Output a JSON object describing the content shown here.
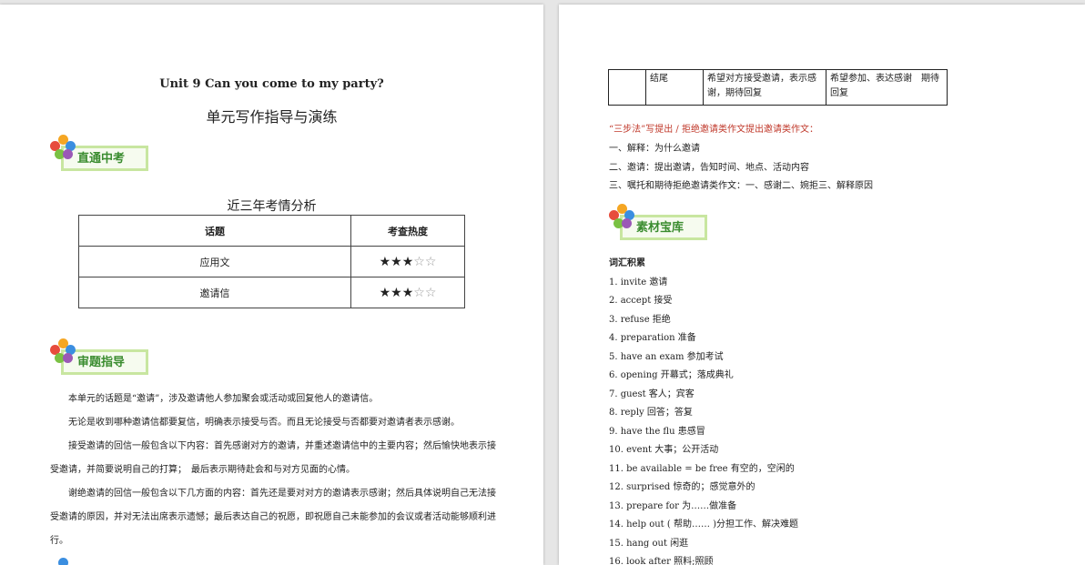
{
  "left": {
    "title_en": "Unit 9 Can you come to my party?",
    "title_cn": "单元写作指导与演练",
    "badge1": "直通中考",
    "table_title": "近三年考情分析",
    "table": {
      "headers": [
        "话题",
        "考查热度"
      ],
      "rows": [
        {
          "topic": "应用文",
          "stars_filled": "★★★",
          "stars_empty": "☆☆"
        },
        {
          "topic": "邀请信",
          "stars_filled": "★★★",
          "stars_empty": "☆☆"
        }
      ]
    },
    "badge2": "审题指导",
    "paragraphs": [
      "本单元的话题是“邀请”，涉及邀请他人参加聚会或活动或回复他人的邀请信。",
      "无论是收到哪种邀请信都要复信，明确表示接受与否。而且无论接受与否都要对邀请者表示感谢。",
      "接受邀请的回信一般包含以下内容：首先感谢对方的邀请，并重述邀请信中的主要内容；然后愉快地表示接受邀请，并简要说明自己的打算；　最后表示期待赴会和与对方见面的心情。",
      "谢绝邀请的回信一般包含以下几方面的内容：首先还是要对对方的邀请表示感谢；然后具体说明自己无法接受邀请的原因，并对无法出席表示遗憾；最后表达自己的祝愿，即祝愿自己未能参加的会议或者活动能够顺利进行。"
    ]
  },
  "right": {
    "table_row": [
      "",
      "结尾",
      "希望对方接受邀请，表示感谢，期待回复",
      "希望参加、表达感谢　期待回复"
    ],
    "red_heading": "“三步法”写提出 / 拒绝邀请类作文提出邀请类作文：",
    "steps": [
      "一、解释：为什么邀请",
      "二、邀请：提出邀请，告知时间、地点、活动内容",
      "三、嘱托和期待拒绝邀请类作文：一、感谢二、婉拒三、解释原因"
    ],
    "badge": "素材宝库",
    "vocab_title": "词汇积累",
    "vocab": [
      "1. invite  邀请",
      "2. accept  接受",
      "3. refuse  拒绝",
      "4. preparation  准备",
      "5. have an exam    参加考试",
      "6. opening  开幕式；落成典礼",
      "7. guest  客人；宾客",
      "8. reply  回答；答复",
      "9. have the flu    患感冒",
      "10. event  大事；公开活动",
      "11. be available = be free  有空的，空闲的",
      "12. surprised  惊奇的；感觉意外的",
      "13. prepare for  为……做准备",
      "14. help out (     帮助……     )分担工作、解决难题",
      "15. hang out  闲逛",
      "16. look after  照料;照顾"
    ]
  },
  "colors": {
    "badge_text": "#3a8c2f",
    "badge_border": "#c8e6a0",
    "red": "#c0392b"
  }
}
